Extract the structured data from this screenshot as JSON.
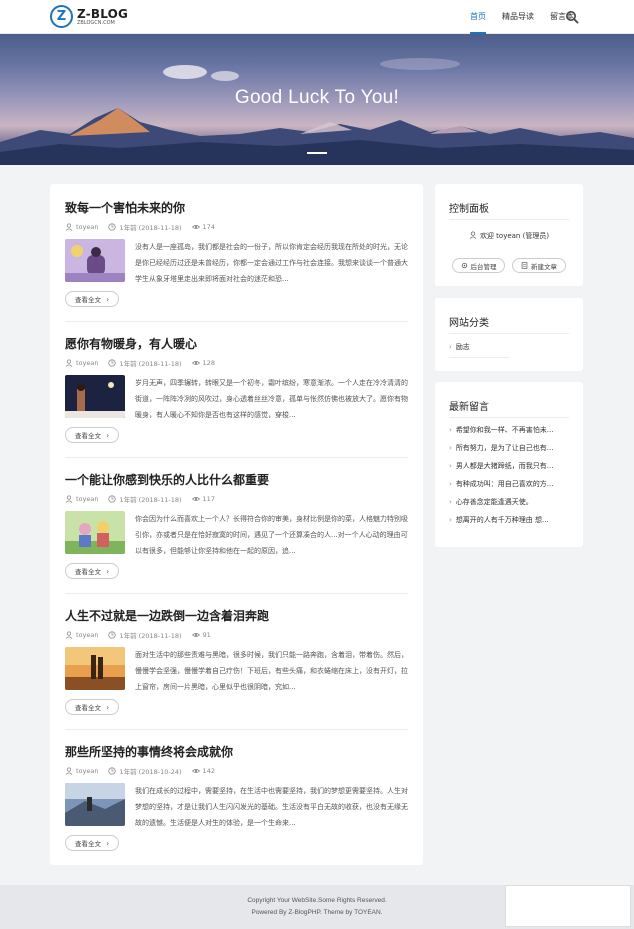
{
  "header": {
    "logo_name": "Z-BLOG",
    "logo_sub": "ZBLOGCN.COM",
    "logo_mark": "Z",
    "nav": [
      "首页",
      "精品导读",
      "留言本"
    ],
    "active_nav": "首页"
  },
  "banner": {
    "title": "Good Luck To You!"
  },
  "posts": [
    {
      "title": "致每一个害怕未来的你",
      "author": "toyean",
      "date": "1年前 (2018-11-18)",
      "views": "174",
      "excerpt": "没有人是一座孤岛，我们都是社会的一份子，所以你肯定会经历我现在所处的时光，无论是你已经经历过还是未曾经历，你都一定会通过工作与社会连接。我想来谈谈一个普通大学生从象牙塔里走出来即将面对社会的迷茫和恐...",
      "readmore": "查看全文"
    },
    {
      "title": "愿你有物暖身，有人暖心",
      "author": "toyean",
      "date": "1年前 (2018-11-18)",
      "views": "128",
      "excerpt": "岁月无声，四季辗转，转眼又是一个初冬，霜叶缤纷，寒意渐浓。一个人走在冷冷清清的街道，一阵阵冷冽的风吹过，身心透着丝丝冷意，孤单与怅然仿佛也被放大了。愿你有物暖身，有人暖心不知你是否也有这样的感觉，穿梭...",
      "readmore": "查看全文"
    },
    {
      "title": "一个能让你感到快乐的人比什么都重要",
      "author": "toyean",
      "date": "1年前 (2018-11-18)",
      "views": "117",
      "excerpt": "你会因为什么而喜欢上一个人？长得符合你的审美，身材比例是你的菜，人格魅力特别吸引你，亦或者只是在恰好寂寞的时间，遇见了一个还算凑合的人...对一个人心动的理由可以有很多，但能够让你坚持和他在一起的原因，追...",
      "readmore": "查看全文"
    },
    {
      "title": "人生不过就是一边跌倒一边含着泪奔跑",
      "author": "toyean",
      "date": "1年前 (2018-11-18)",
      "views": "91",
      "excerpt": "面对生活中的那些责难与黑暗，很多时候，我们只能一路奔跑，含着泪，带着伤。然后，慢慢学会坚强，慢慢学着自己疗伤！下班后，有些头痛，和衣蜷缩在床上，没有开灯，拉上窗帘，房间一片黑暗，心里似乎也很阴暗，究如...",
      "readmore": "查看全文"
    },
    {
      "title": "那些所坚持的事情终将会成就你",
      "author": "toyean",
      "date": "1年前 (2018-10-24)",
      "views": "142",
      "excerpt": "我们在成长的过程中，需要坚持，在生活中也需要坚持，我们的梦想更需要坚持。人生对梦想的坚持，才是让我们人生闪闪发光的基础。生活没有平白无故的收获，也没有无缘无故的遗憾。生活便是人对生的体验，是一个生命来...",
      "readmore": "查看全文"
    }
  ],
  "sidebar": {
    "control": {
      "title": "控制面板",
      "welcome": "欢迎 toyean (管理员)",
      "btn_admin": "后台管理",
      "btn_new": "新建文章"
    },
    "categories": {
      "title": "网站分类",
      "items": [
        "励志"
      ]
    },
    "comments": {
      "title": "最新留言",
      "items": [
        "希望你和我一样、不再害怕未...",
        "所有努力，是为了让自己也有...",
        "男人都是大猪蹄纸，而我只有...",
        "有种成功叫：用自己喜欢的方...",
        "心存善念定能逢遇天使。",
        "想离开的人有千万种理由 想..."
      ]
    }
  },
  "footer": {
    "line1": "Copyright Your WebSite.Some Rights Reserved.",
    "line2": "Powered By Z-BlogPHP. Theme by TOYEAN."
  },
  "colors": {
    "accent": "#1e73be"
  }
}
